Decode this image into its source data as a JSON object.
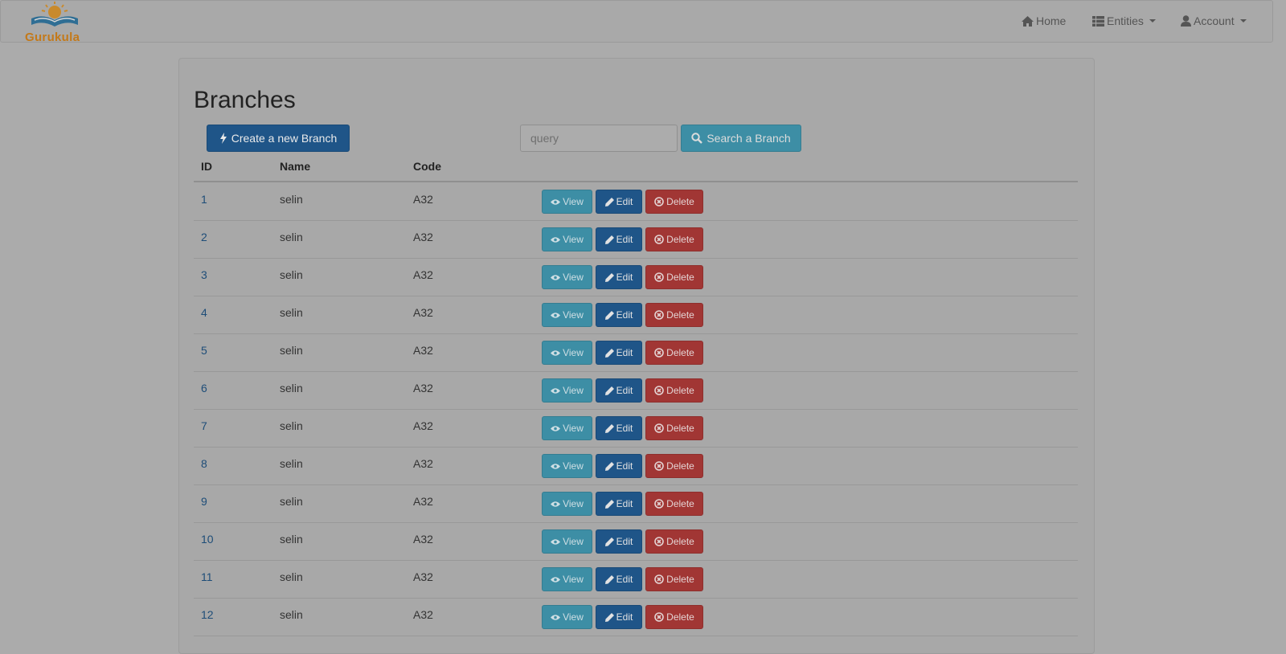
{
  "brand": {
    "name": "Gurukula"
  },
  "nav": {
    "home": "Home",
    "entities": "Entities",
    "account": "Account"
  },
  "page": {
    "title": "Branches",
    "create_label": "Create a new Branch",
    "search_placeholder": "query",
    "search_label": "Search a Branch"
  },
  "table": {
    "headers": {
      "id": "ID",
      "name": "Name",
      "code": "Code"
    },
    "actions": {
      "view": "View",
      "edit": "Edit",
      "delete": "Delete"
    },
    "rows": [
      {
        "id": "1",
        "name": "selin",
        "code": "A32"
      },
      {
        "id": "2",
        "name": "selin",
        "code": "A32"
      },
      {
        "id": "3",
        "name": "selin",
        "code": "A32"
      },
      {
        "id": "4",
        "name": "selin",
        "code": "A32"
      },
      {
        "id": "5",
        "name": "selin",
        "code": "A32"
      },
      {
        "id": "6",
        "name": "selin",
        "code": "A32"
      },
      {
        "id": "7",
        "name": "selin",
        "code": "A32"
      },
      {
        "id": "8",
        "name": "selin",
        "code": "A32"
      },
      {
        "id": "9",
        "name": "selin",
        "code": "A32"
      },
      {
        "id": "10",
        "name": "selin",
        "code": "A32"
      },
      {
        "id": "11",
        "name": "selin",
        "code": "A32"
      },
      {
        "id": "12",
        "name": "selin",
        "code": "A32"
      }
    ]
  },
  "icons": {
    "home": "home-icon",
    "entities": "th-list-icon",
    "account": "user-icon",
    "create": "bolt-icon",
    "search": "search-icon",
    "view": "eye-icon",
    "edit": "pencil-icon",
    "delete": "remove-circle-icon"
  },
  "colors": {
    "primary": "#1f5588",
    "info": "#3d8ea5",
    "danger": "#a13634",
    "brand": "#c3791a",
    "link": "#1e4d78"
  }
}
